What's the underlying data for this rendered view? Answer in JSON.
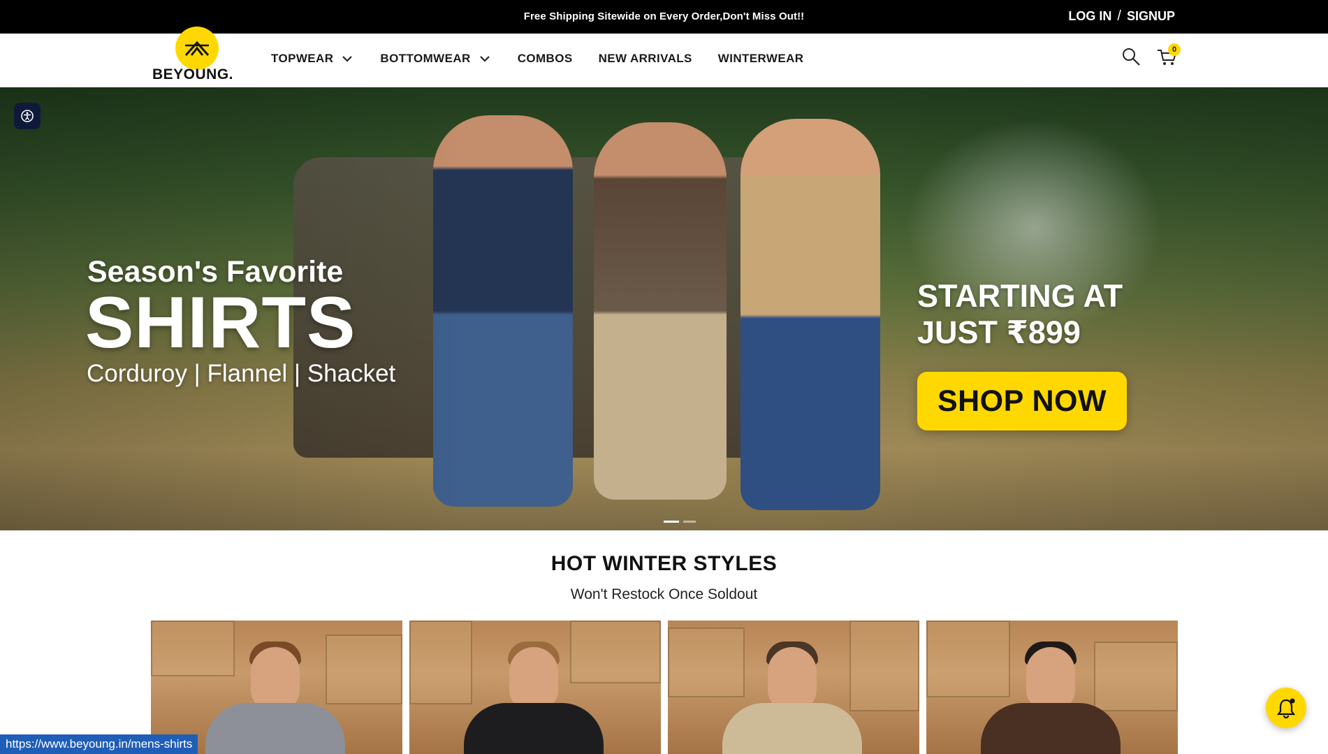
{
  "topbar": {
    "promo": "Free Shipping Sitewide on Every Order,Don't Miss Out!!",
    "login": "LOG IN",
    "separator": "/",
    "signup": "SIGNUP"
  },
  "brand": {
    "name": "BEYOUNG."
  },
  "nav": {
    "items": [
      {
        "label": "TOPWEAR"
      },
      {
        "label": "BOTTOMWEAR"
      },
      {
        "label": "COMBOS"
      },
      {
        "label": "NEW ARRIVALS"
      },
      {
        "label": "WINTERWEAR"
      }
    ]
  },
  "cart": {
    "count": "0"
  },
  "hero": {
    "line1": "Season's Favorite",
    "line2": "SHIRTS",
    "line3": "Corduroy | Flannel | Shacket",
    "price_line1": "STARTING AT",
    "price_line2": "JUST ₹899",
    "cta": "SHOP NOW"
  },
  "section": {
    "title": "HOT WINTER STYLES",
    "subtitle": "Won't Restock Once Soldout"
  },
  "status": {
    "url": "https://www.beyoung.in/mens-shirts"
  },
  "colors": {
    "accent": "#ffd800",
    "topbar": "#000000",
    "status": "#1f5eb6"
  },
  "icons": [
    "logo-tent-icon",
    "chevron-down-icon",
    "search-icon",
    "cart-icon",
    "accessibility-icon",
    "bell-icon"
  ]
}
